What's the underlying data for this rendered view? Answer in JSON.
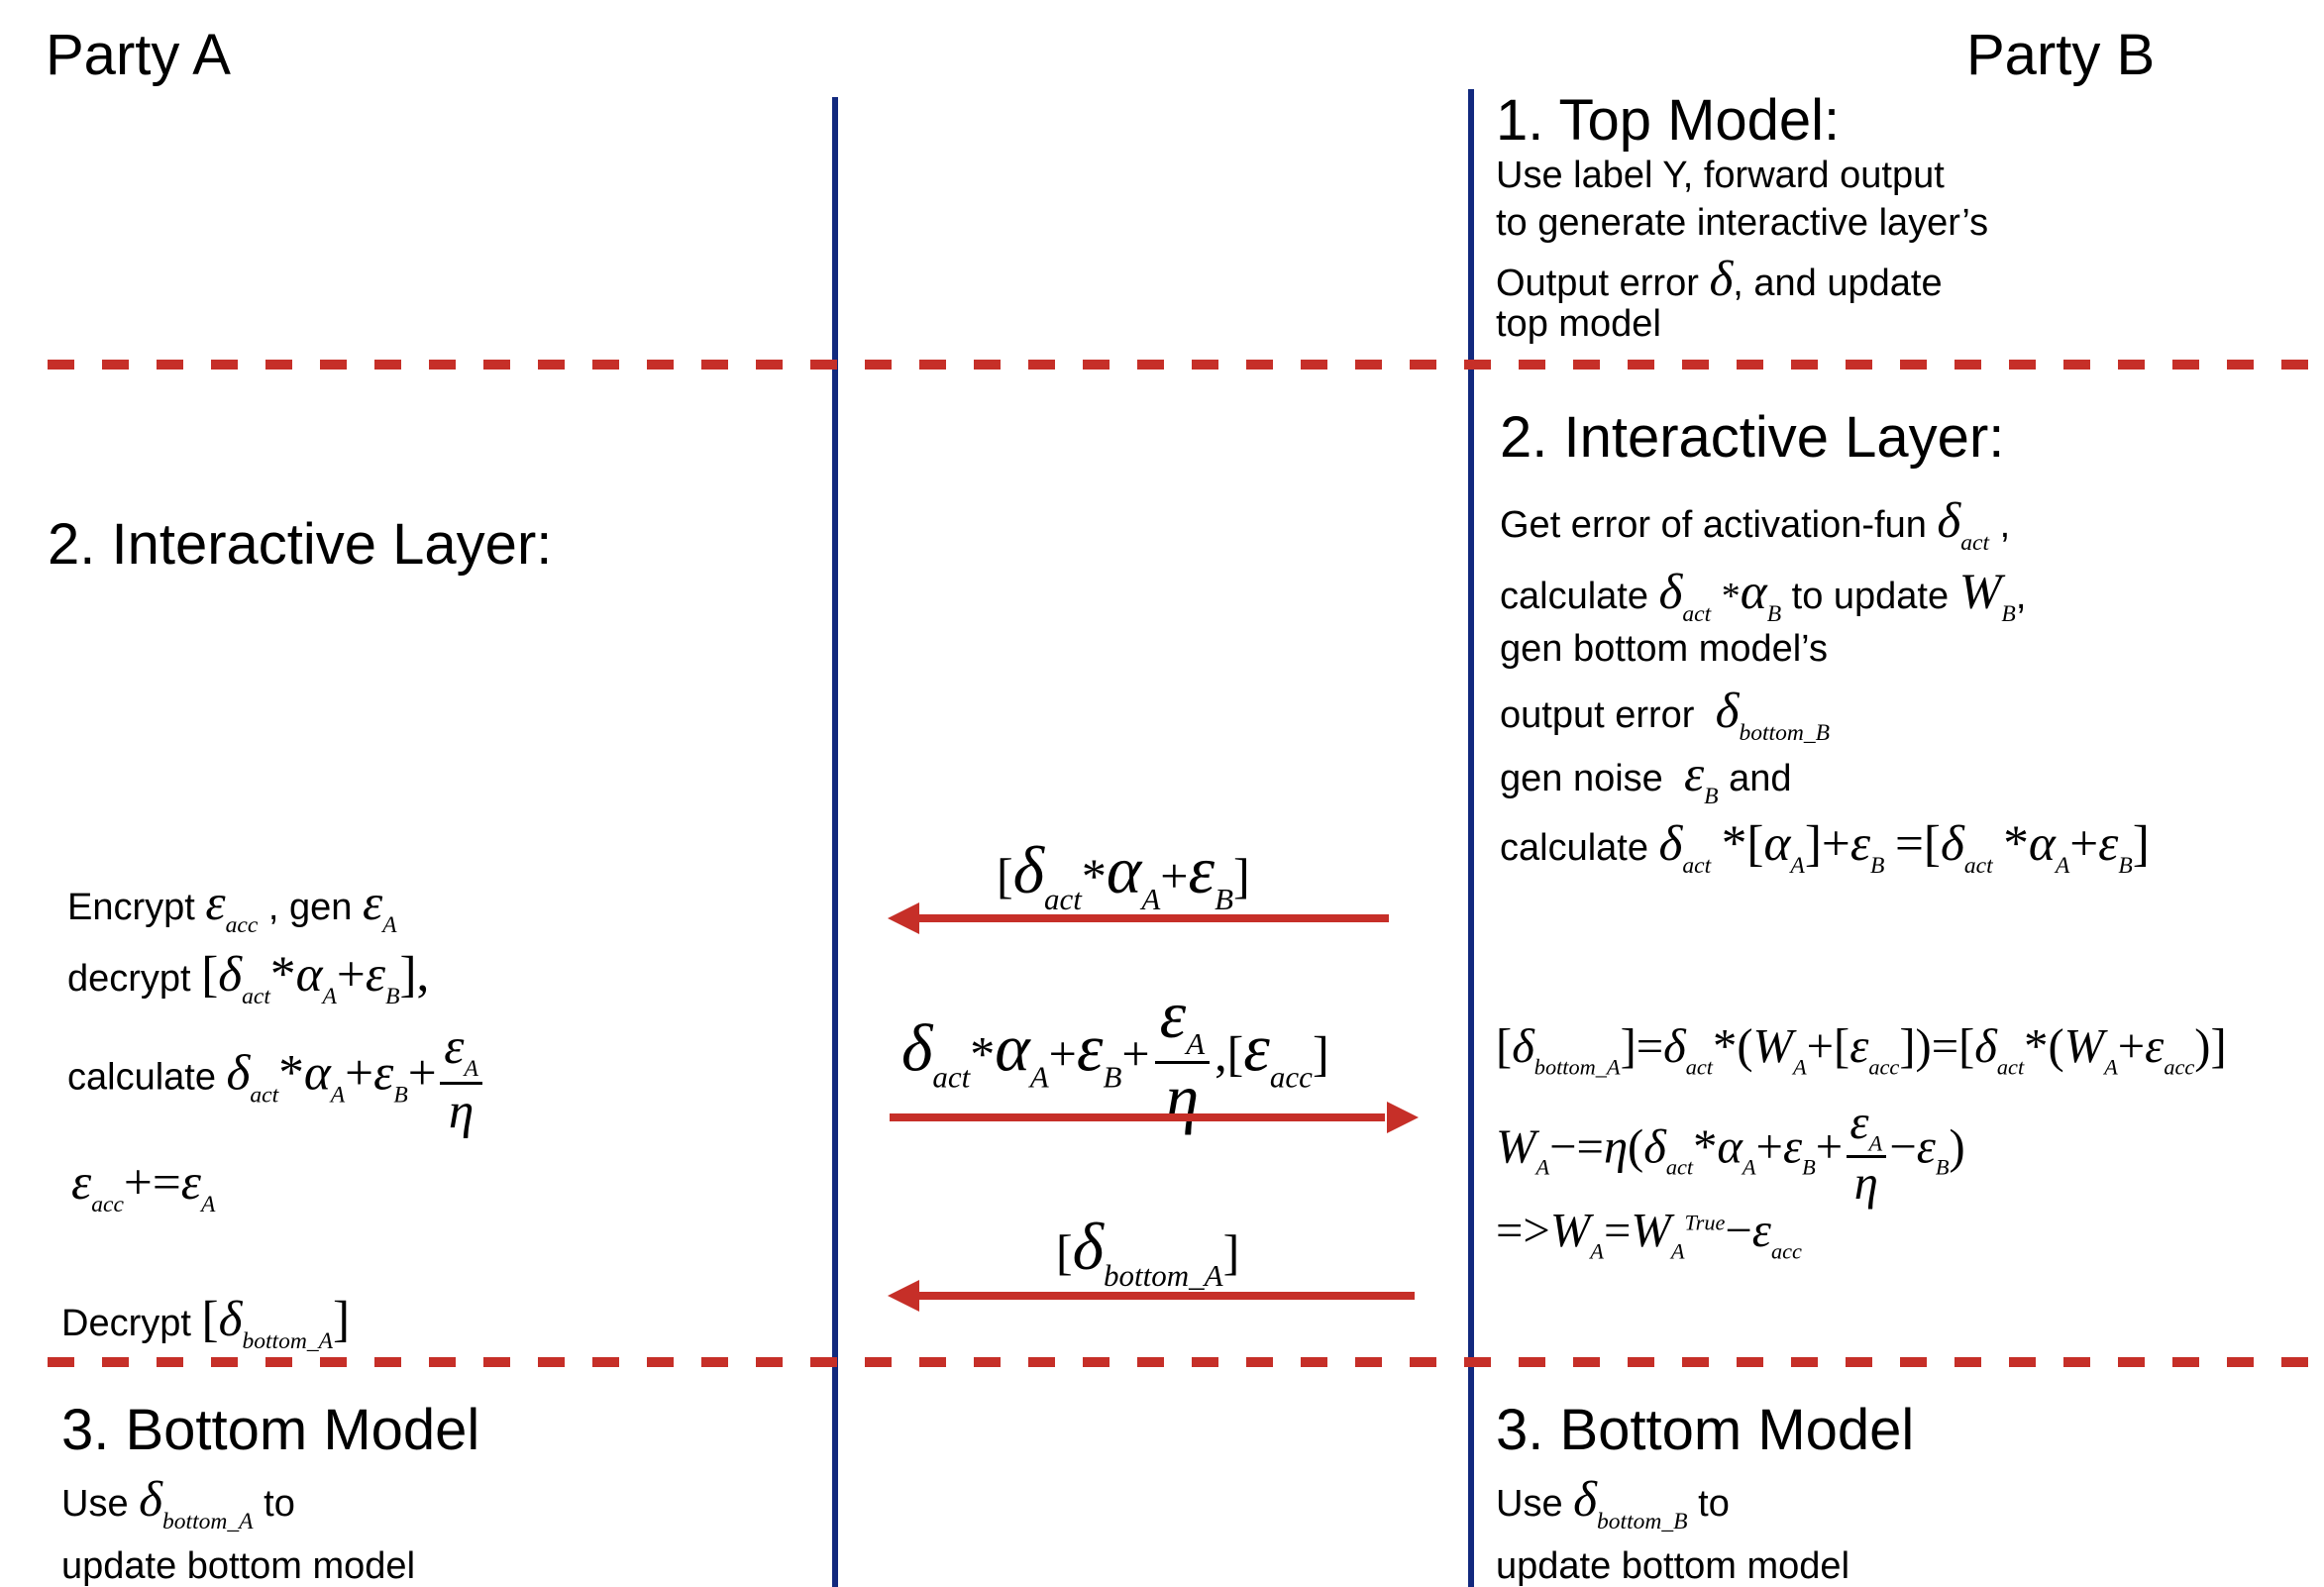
{
  "parties": {
    "a": "Party A",
    "b": "Party B"
  },
  "colors": {
    "divider_vertical": "#12297e",
    "divider_dashed": "#c62f28",
    "arrow": "#c62f28",
    "text": "#000000"
  },
  "party_b": {
    "top_model": {
      "title": "1. Top Model:",
      "lines": [
        "Use label Y,  forward output",
        "to generate interactive layer’s",
        "Output error",
        ",  and update",
        "top model"
      ]
    },
    "interactive": {
      "title": "2. Interactive Layer:",
      "line1": "Get error of activation-fun",
      "line2_a": "calculate",
      "line2_b": "to update",
      "line3": "gen bottom model’s",
      "line4": "output error",
      "line5_a": "gen noise",
      "line5_b": "and",
      "line6": "calculate"
    },
    "equations": {
      "eq1": "[δbottom_A] = δact * (WA + [εacc]) = [δact * (WA + εacc)]",
      "eq2": "WA −= η(δact * αA + εB + εA/η − εB)",
      "eq3": "=> WA = WA^True − εacc"
    },
    "bottom_model": {
      "title": "3. Bottom Model",
      "line1_a": "Use",
      "line1_b": "to",
      "line2": "update bottom model"
    }
  },
  "party_a": {
    "interactive": {
      "title": "2. Interactive Layer:",
      "line1_a": "Encrypt",
      "line1_b": ",  gen",
      "line2": "decrypt",
      "line3": "calculate",
      "line4": "εacc += εA",
      "line5": "Decrypt"
    },
    "bottom_model": {
      "title": "3. Bottom Model",
      "line1_a": "Use",
      "line1_b": "to",
      "line2": "update bottom model"
    }
  },
  "messages": [
    {
      "label": "[δact * αA + εB]",
      "direction": "B-to-A"
    },
    {
      "label": "δact * αA + εB + εA/η, [εacc]",
      "direction": "A-to-B"
    },
    {
      "label": "[δbottom_A]",
      "direction": "B-to-A"
    }
  ],
  "symbols": {
    "delta": "δ",
    "alpha": "α",
    "epsilon": "ε",
    "eta": "η",
    "W": "W",
    "star": "*",
    "act": "act",
    "acc": "acc",
    "A": "A",
    "B": "B",
    "bottomA": "bottom_A",
    "bottomB": "bottom_B",
    "True": "True"
  }
}
